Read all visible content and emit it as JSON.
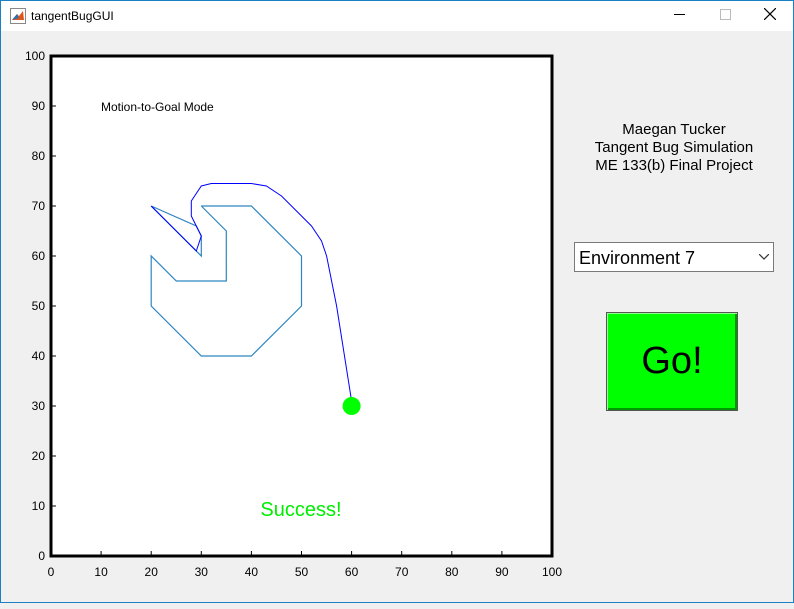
{
  "window": {
    "title": "tangentBugGUI"
  },
  "plot": {
    "mode_label": "Motion-to-Goal Mode",
    "status_text": "Success!",
    "x_ticks": [
      "0",
      "10",
      "20",
      "30",
      "40",
      "50",
      "60",
      "70",
      "80",
      "90",
      "100"
    ],
    "y_ticks": [
      "0",
      "10",
      "20",
      "30",
      "40",
      "50",
      "60",
      "70",
      "80",
      "90",
      "100"
    ],
    "xlim": [
      0,
      100
    ],
    "ylim": [
      0,
      100
    ],
    "obstacle": [
      [
        20,
        70
      ],
      [
        30,
        60
      ],
      [
        30,
        64
      ],
      [
        29,
        66
      ],
      [
        20,
        70
      ]
    ],
    "obstacle_main": [
      [
        30,
        70
      ],
      [
        40,
        70
      ],
      [
        50,
        60
      ],
      [
        50,
        50
      ],
      [
        40,
        40
      ],
      [
        30,
        40
      ],
      [
        20,
        50
      ],
      [
        20,
        60
      ],
      [
        25,
        55
      ],
      [
        35,
        55
      ],
      [
        35,
        65
      ],
      [
        30,
        70
      ]
    ],
    "path": [
      [
        20,
        70
      ],
      [
        29,
        61
      ],
      [
        30,
        64
      ],
      [
        28,
        68
      ],
      [
        28,
        71
      ],
      [
        30,
        74
      ],
      [
        32,
        74.5
      ],
      [
        38,
        74.5
      ],
      [
        40,
        74.5
      ],
      [
        43,
        74
      ],
      [
        46,
        72
      ],
      [
        52,
        66
      ],
      [
        54,
        63
      ],
      [
        55,
        60
      ],
      [
        57,
        50
      ],
      [
        60,
        31
      ]
    ],
    "goal": [
      60,
      30
    ],
    "colors": {
      "obstacle": "#2e86c1",
      "path": "#0000ff",
      "goal": "#00ff00",
      "status": "#00ee00"
    }
  },
  "credits": {
    "line1": "Maegan Tucker",
    "line2": "Tangent Bug Simulation",
    "line3": "ME 133(b) Final Project"
  },
  "environment_select": {
    "value": "Environment 7"
  },
  "go_button": {
    "label": "Go!"
  }
}
